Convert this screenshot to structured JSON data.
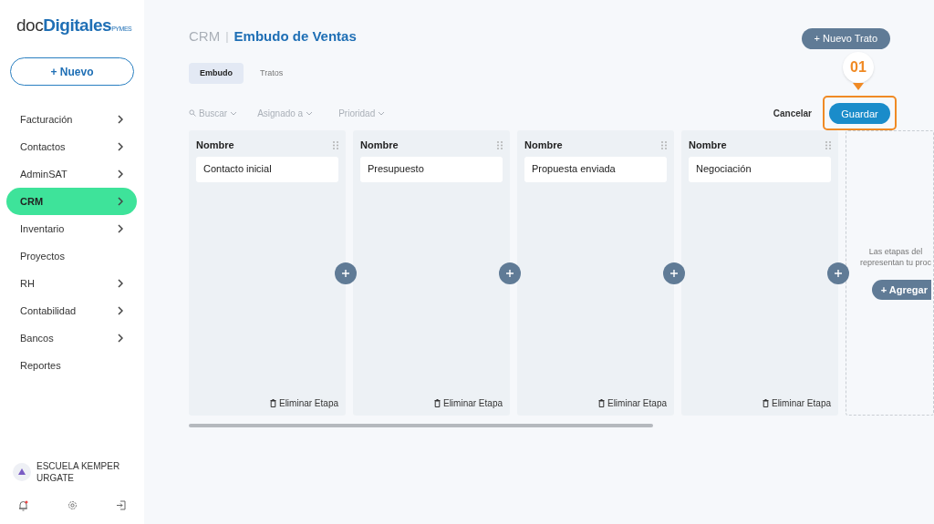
{
  "logo": {
    "part_1": "doc",
    "part_2": "Digitales",
    "part_3": "PYMES"
  },
  "new_button": "+ Nuevo",
  "sidebar": {
    "items": [
      {
        "label": "Facturación",
        "expandable": true,
        "selected": false
      },
      {
        "label": "Contactos",
        "expandable": true,
        "selected": false
      },
      {
        "label": "AdminSAT",
        "expandable": true,
        "selected": false
      },
      {
        "label": "CRM",
        "expandable": true,
        "selected": true
      },
      {
        "label": "Inventario",
        "expandable": true,
        "selected": false
      },
      {
        "label": "Proyectos",
        "expandable": false,
        "selected": false
      },
      {
        "label": "RH",
        "expandable": true,
        "selected": false
      },
      {
        "label": "Contabilidad",
        "expandable": true,
        "selected": false
      },
      {
        "label": "Bancos",
        "expandable": true,
        "selected": false
      },
      {
        "label": "Reportes",
        "expandable": false,
        "selected": false
      }
    ],
    "account": {
      "name": "ESCUELA KEMPER URGATE"
    }
  },
  "breadcrumb": {
    "section": "CRM",
    "separator": "|",
    "title": "Embudo de Ventas"
  },
  "new_deal_button": "+ Nuevo Trato",
  "tabs": [
    {
      "label": "Embudo",
      "selected": true
    },
    {
      "label": "Tratos",
      "selected": false
    }
  ],
  "filters": [
    "Buscar",
    "Asignado a",
    "Prioridad"
  ],
  "cancel_button": "Cancelar",
  "save_button": "Guardar",
  "callout": "01",
  "stages": [
    {
      "header": "Nombre",
      "name": "Contacto inicial",
      "delete": "Eliminar Etapa"
    },
    {
      "header": "Nombre",
      "name": "Presupuesto",
      "delete": "Eliminar Etapa"
    },
    {
      "header": "Nombre",
      "name": "Propuesta enviada",
      "delete": "Eliminar Etapa"
    },
    {
      "header": "Nombre",
      "name": "Negociación",
      "delete": "Eliminar Etapa"
    }
  ],
  "add_stage_panel": {
    "lines": [
      "Las etapas del",
      "representan tu proc"
    ],
    "button": "+ Agregar"
  }
}
